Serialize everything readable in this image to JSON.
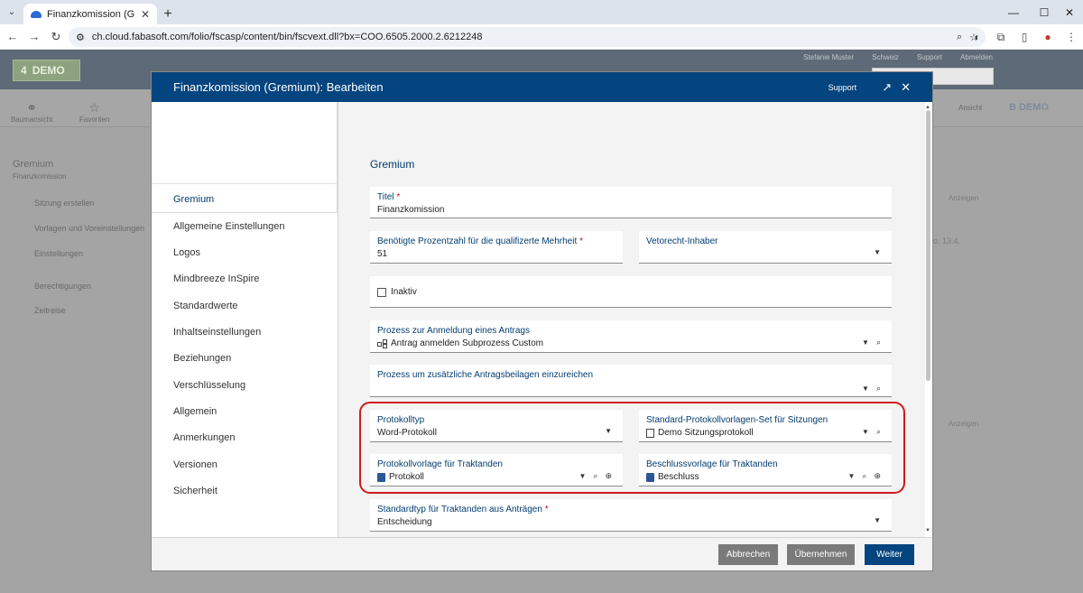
{
  "browser": {
    "tab_title": "Finanzkomission (Gremium): Be",
    "url": "ch.cloud.fabasoft.com/folio/fscasp/content/bin/fscvext.dll?bx=COO.6505.2000.2.6212248"
  },
  "background_app": {
    "logo": "DEMO",
    "top_links": [
      "Stefanie Muster",
      "Schweiz",
      "Support",
      "Abmelden"
    ],
    "sub_items": [
      "Baumansicht",
      "Favoriten"
    ],
    "right_items": [
      "Ansicht",
      "DEMO"
    ],
    "left_title": "Gremium",
    "left_subtitle": "Finanzkomission",
    "left_links": [
      "Sitzung erstellen",
      "Vorlagen und Voreinstellungen",
      "Einstellungen",
      "Berechtigungen",
      "Zeitreise"
    ],
    "right_label_1": "Anzeigen",
    "right_label_2": "Anzeigen",
    "right_text": "o. 13.4."
  },
  "modal": {
    "title": "Finanzkomission (Gremium): Bearbeiten",
    "support": "Support",
    "nav": [
      "Gremium",
      "Allgemeine Einstellungen",
      "Logos",
      "Mindbreeze InSpire",
      "Standardwerte",
      "Inhaltseinstellungen",
      "Beziehungen",
      "Verschlüsselung",
      "Allgemein",
      "Anmerkungen",
      "Versionen",
      "Sicherheit"
    ],
    "section_title": "Gremium",
    "fields": {
      "titel_label": "Titel",
      "titel_value": "Finanzkomission",
      "prozent_label": "Benötigte Prozentzahl für die qualifizerte Mehrheit",
      "prozent_value": "51",
      "veto_label": "Vetorecht-Inhaber",
      "inaktiv_label": "Inaktiv",
      "prozess_anmeldung_label": "Prozess zur Anmeldung eines Antrags",
      "prozess_anmeldung_value": "Antrag anmelden Subprozess Custom",
      "prozess_beilagen_label": "Prozess um zusätzliche Antragsbeilagen einzureichen",
      "protokolltyp_label": "Protokolltyp",
      "protokolltyp_value": "Word-Protokoll",
      "std_set_label": "Standard-Protokollvorlagen-Set für Sitzungen",
      "std_set_value": "Demo Sitzungsprotokoll",
      "protokollvorlage_label": "Protokollvorlage für Traktanden",
      "protokollvorlage_value": "Protokoll",
      "beschluss_label": "Beschlussvorlage für Traktanden",
      "beschluss_value": "Beschluss",
      "standardtyp_label": "Standardtyp für Traktanden aus Anträgen",
      "standardtyp_value": "Entscheidung"
    },
    "buttons": {
      "abbrechen": "Abbrechen",
      "uebernehmen": "Übernehmen",
      "weiter": "Weiter"
    }
  }
}
